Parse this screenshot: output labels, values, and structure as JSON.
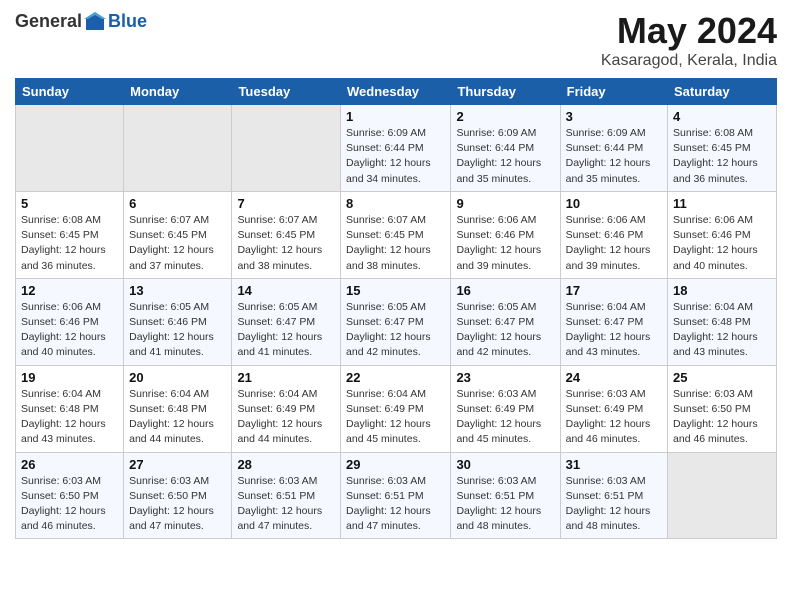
{
  "header": {
    "logo_general": "General",
    "logo_blue": "Blue",
    "month_year": "May 2024",
    "location": "Kasaragod, Kerala, India"
  },
  "weekdays": [
    "Sunday",
    "Monday",
    "Tuesday",
    "Wednesday",
    "Thursday",
    "Friday",
    "Saturday"
  ],
  "weeks": [
    [
      {
        "day": "",
        "info": ""
      },
      {
        "day": "",
        "info": ""
      },
      {
        "day": "",
        "info": ""
      },
      {
        "day": "1",
        "info": "Sunrise: 6:09 AM\nSunset: 6:44 PM\nDaylight: 12 hours\nand 34 minutes."
      },
      {
        "day": "2",
        "info": "Sunrise: 6:09 AM\nSunset: 6:44 PM\nDaylight: 12 hours\nand 35 minutes."
      },
      {
        "day": "3",
        "info": "Sunrise: 6:09 AM\nSunset: 6:44 PM\nDaylight: 12 hours\nand 35 minutes."
      },
      {
        "day": "4",
        "info": "Sunrise: 6:08 AM\nSunset: 6:45 PM\nDaylight: 12 hours\nand 36 minutes."
      }
    ],
    [
      {
        "day": "5",
        "info": "Sunrise: 6:08 AM\nSunset: 6:45 PM\nDaylight: 12 hours\nand 36 minutes."
      },
      {
        "day": "6",
        "info": "Sunrise: 6:07 AM\nSunset: 6:45 PM\nDaylight: 12 hours\nand 37 minutes."
      },
      {
        "day": "7",
        "info": "Sunrise: 6:07 AM\nSunset: 6:45 PM\nDaylight: 12 hours\nand 38 minutes."
      },
      {
        "day": "8",
        "info": "Sunrise: 6:07 AM\nSunset: 6:45 PM\nDaylight: 12 hours\nand 38 minutes."
      },
      {
        "day": "9",
        "info": "Sunrise: 6:06 AM\nSunset: 6:46 PM\nDaylight: 12 hours\nand 39 minutes."
      },
      {
        "day": "10",
        "info": "Sunrise: 6:06 AM\nSunset: 6:46 PM\nDaylight: 12 hours\nand 39 minutes."
      },
      {
        "day": "11",
        "info": "Sunrise: 6:06 AM\nSunset: 6:46 PM\nDaylight: 12 hours\nand 40 minutes."
      }
    ],
    [
      {
        "day": "12",
        "info": "Sunrise: 6:06 AM\nSunset: 6:46 PM\nDaylight: 12 hours\nand 40 minutes."
      },
      {
        "day": "13",
        "info": "Sunrise: 6:05 AM\nSunset: 6:46 PM\nDaylight: 12 hours\nand 41 minutes."
      },
      {
        "day": "14",
        "info": "Sunrise: 6:05 AM\nSunset: 6:47 PM\nDaylight: 12 hours\nand 41 minutes."
      },
      {
        "day": "15",
        "info": "Sunrise: 6:05 AM\nSunset: 6:47 PM\nDaylight: 12 hours\nand 42 minutes."
      },
      {
        "day": "16",
        "info": "Sunrise: 6:05 AM\nSunset: 6:47 PM\nDaylight: 12 hours\nand 42 minutes."
      },
      {
        "day": "17",
        "info": "Sunrise: 6:04 AM\nSunset: 6:47 PM\nDaylight: 12 hours\nand 43 minutes."
      },
      {
        "day": "18",
        "info": "Sunrise: 6:04 AM\nSunset: 6:48 PM\nDaylight: 12 hours\nand 43 minutes."
      }
    ],
    [
      {
        "day": "19",
        "info": "Sunrise: 6:04 AM\nSunset: 6:48 PM\nDaylight: 12 hours\nand 43 minutes."
      },
      {
        "day": "20",
        "info": "Sunrise: 6:04 AM\nSunset: 6:48 PM\nDaylight: 12 hours\nand 44 minutes."
      },
      {
        "day": "21",
        "info": "Sunrise: 6:04 AM\nSunset: 6:49 PM\nDaylight: 12 hours\nand 44 minutes."
      },
      {
        "day": "22",
        "info": "Sunrise: 6:04 AM\nSunset: 6:49 PM\nDaylight: 12 hours\nand 45 minutes."
      },
      {
        "day": "23",
        "info": "Sunrise: 6:03 AM\nSunset: 6:49 PM\nDaylight: 12 hours\nand 45 minutes."
      },
      {
        "day": "24",
        "info": "Sunrise: 6:03 AM\nSunset: 6:49 PM\nDaylight: 12 hours\nand 46 minutes."
      },
      {
        "day": "25",
        "info": "Sunrise: 6:03 AM\nSunset: 6:50 PM\nDaylight: 12 hours\nand 46 minutes."
      }
    ],
    [
      {
        "day": "26",
        "info": "Sunrise: 6:03 AM\nSunset: 6:50 PM\nDaylight: 12 hours\nand 46 minutes."
      },
      {
        "day": "27",
        "info": "Sunrise: 6:03 AM\nSunset: 6:50 PM\nDaylight: 12 hours\nand 47 minutes."
      },
      {
        "day": "28",
        "info": "Sunrise: 6:03 AM\nSunset: 6:51 PM\nDaylight: 12 hours\nand 47 minutes."
      },
      {
        "day": "29",
        "info": "Sunrise: 6:03 AM\nSunset: 6:51 PM\nDaylight: 12 hours\nand 47 minutes."
      },
      {
        "day": "30",
        "info": "Sunrise: 6:03 AM\nSunset: 6:51 PM\nDaylight: 12 hours\nand 48 minutes."
      },
      {
        "day": "31",
        "info": "Sunrise: 6:03 AM\nSunset: 6:51 PM\nDaylight: 12 hours\nand 48 minutes."
      },
      {
        "day": "",
        "info": ""
      }
    ]
  ]
}
